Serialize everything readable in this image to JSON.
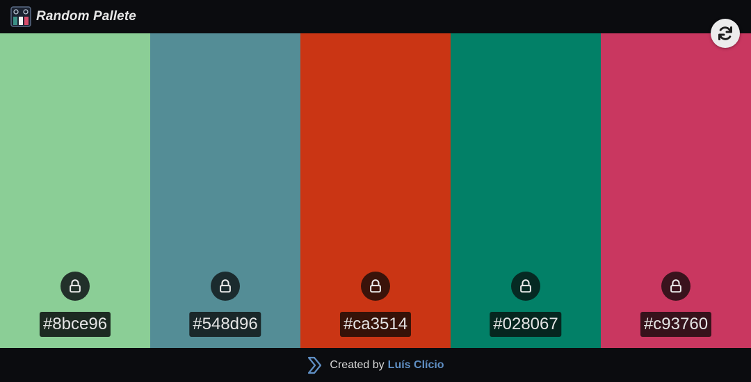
{
  "header": {
    "title": "Random Pallete"
  },
  "palette": [
    {
      "hex": "#8bce96",
      "locked": false,
      "overlay_lock": "#22302a",
      "overlay_label": "#1d2a22"
    },
    {
      "hex": "#548d96",
      "locked": false,
      "overlay_lock": "#1b2b2e",
      "overlay_label": "#1a2729"
    },
    {
      "hex": "#ca3514",
      "locked": false,
      "overlay_lock": "#3a130a",
      "overlay_label": "#361208"
    },
    {
      "hex": "#028067",
      "locked": false,
      "overlay_lock": "#062a23",
      "overlay_label": "#06261f"
    },
    {
      "hex": "#c93760",
      "locked": false,
      "overlay_lock": "#3a131d",
      "overlay_label": "#36121b"
    }
  ],
  "footer": {
    "text": "Created by",
    "author": "Luís Clício",
    "link_color": "#5f8fc4"
  },
  "icons": {
    "refresh": "refresh-icon",
    "lock": "unlock-icon",
    "logo": "palette-logo-icon",
    "footer": "chevron-logo-icon"
  }
}
